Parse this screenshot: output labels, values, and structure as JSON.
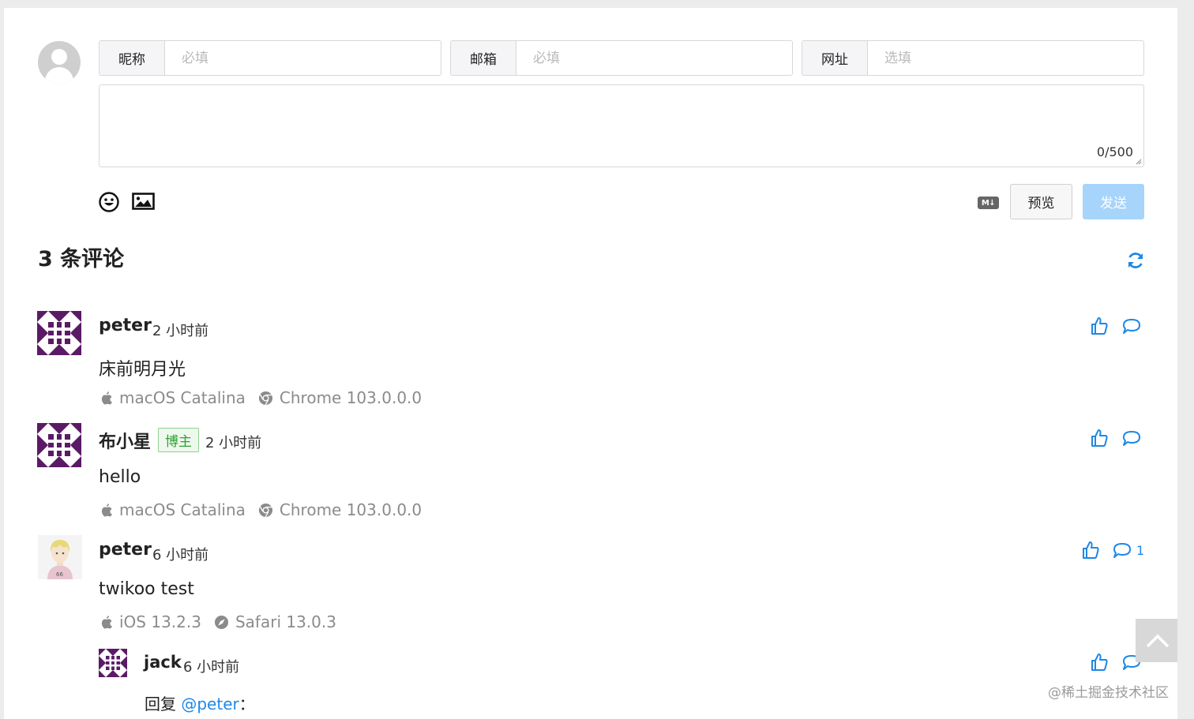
{
  "form": {
    "fields": [
      {
        "label": "昵称",
        "placeholder": "必填",
        "value": ""
      },
      {
        "label": "邮箱",
        "placeholder": "必填",
        "value": ""
      },
      {
        "label": "网址",
        "placeholder": "选填",
        "value": ""
      }
    ],
    "counter": "0/500",
    "md_label": "M↓",
    "preview_label": "预览",
    "send_label": "发送"
  },
  "comments_header": {
    "title": "3 条评论"
  },
  "comments": [
    {
      "nick": "peter",
      "time": "2 小时前",
      "badge": "",
      "content": "床前明月光",
      "os": "macOS Catalina",
      "browser": "Chrome 103.0.0.0",
      "replies": ""
    },
    {
      "nick": "布小星",
      "time": "2 小时前",
      "badge": "博主",
      "content": "hello",
      "os": "macOS Catalina",
      "browser": "Chrome 103.0.0.0",
      "replies": ""
    },
    {
      "nick": "peter",
      "time": "6 小时前",
      "badge": "",
      "content": "twikoo test",
      "os": "iOS 13.2.3",
      "browser": "Safari 13.0.3",
      "replies": "1"
    }
  ],
  "reply": {
    "nick": "jack",
    "time": "6 小时前",
    "prefix": "回复",
    "mention": "@peter",
    "suffix": "："
  },
  "watermark": "@稀土掘金技术社区",
  "colors": {
    "accent": "#1e88e5",
    "send_disabled": "#a6d4fb",
    "identicon": "#5b1a66",
    "badge_green": "#2fa12f"
  },
  "icons": [
    "avatar-placeholder-icon",
    "emoji-icon",
    "image-icon",
    "markdown-icon",
    "refresh-icon",
    "thumbs-up-icon",
    "comment-icon",
    "apple-icon",
    "chrome-icon",
    "safari-icon",
    "back-to-top-icon"
  ]
}
